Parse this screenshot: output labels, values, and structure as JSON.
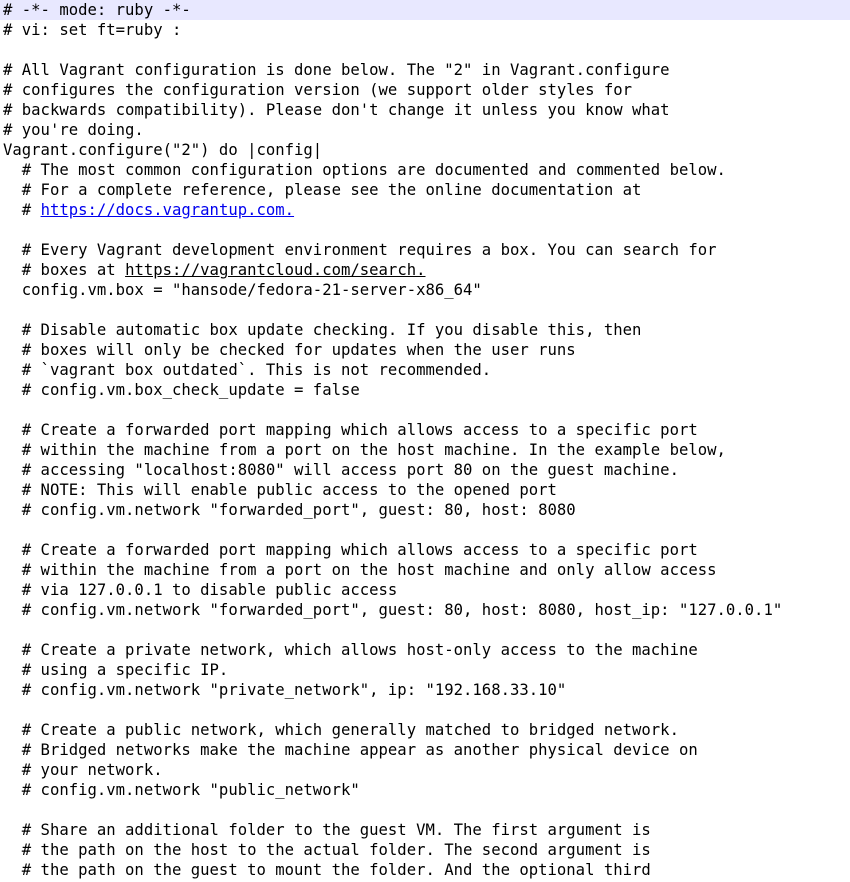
{
  "editor": {
    "current_line_color": "#e8e8ff",
    "link_color": "#0000ee",
    "lines": [
      {
        "text": "# -*- mode: ruby -*-"
      },
      {
        "text": "# vi: set ft=ruby :"
      },
      {
        "text": ""
      },
      {
        "text": "# All Vagrant configuration is done below. The \"2\" in Vagrant.configure"
      },
      {
        "text": "# configures the configuration version (we support older styles for"
      },
      {
        "text": "# backwards compatibility). Please don't change it unless you know what"
      },
      {
        "text": "# you're doing."
      },
      {
        "text": "Vagrant.configure(\"2\") do |config|"
      },
      {
        "text": "  # The most common configuration options are documented and commented below."
      },
      {
        "text": "  # For a complete reference, please see the online documentation at"
      },
      {
        "prefix": "  # ",
        "link": "https://docs.vagrantup.com.",
        "suffix": "",
        "link_style": "blue"
      },
      {
        "text": ""
      },
      {
        "text": "  # Every Vagrant development environment requires a box. You can search for"
      },
      {
        "prefix": "  # boxes at ",
        "link": "https://vagrantcloud.com/search.",
        "suffix": "",
        "link_style": "plain"
      },
      {
        "text": "  config.vm.box = \"hansode/fedora-21-server-x86_64\""
      },
      {
        "text": ""
      },
      {
        "text": "  # Disable automatic box update checking. If you disable this, then"
      },
      {
        "text": "  # boxes will only be checked for updates when the user runs"
      },
      {
        "text": "  # `vagrant box outdated`. This is not recommended."
      },
      {
        "text": "  # config.vm.box_check_update = false"
      },
      {
        "text": ""
      },
      {
        "text": "  # Create a forwarded port mapping which allows access to a specific port"
      },
      {
        "text": "  # within the machine from a port on the host machine. In the example below,"
      },
      {
        "text": "  # accessing \"localhost:8080\" will access port 80 on the guest machine."
      },
      {
        "text": "  # NOTE: This will enable public access to the opened port"
      },
      {
        "text": "  # config.vm.network \"forwarded_port\", guest: 80, host: 8080"
      },
      {
        "text": ""
      },
      {
        "text": "  # Create a forwarded port mapping which allows access to a specific port"
      },
      {
        "text": "  # within the machine from a port on the host machine and only allow access"
      },
      {
        "text": "  # via 127.0.0.1 to disable public access"
      },
      {
        "text": "  # config.vm.network \"forwarded_port\", guest: 80, host: 8080, host_ip: \"127.0.0.1\""
      },
      {
        "text": ""
      },
      {
        "text": "  # Create a private network, which allows host-only access to the machine"
      },
      {
        "text": "  # using a specific IP."
      },
      {
        "text": "  # config.vm.network \"private_network\", ip: \"192.168.33.10\""
      },
      {
        "text": ""
      },
      {
        "text": "  # Create a public network, which generally matched to bridged network."
      },
      {
        "text": "  # Bridged networks make the machine appear as another physical device on"
      },
      {
        "text": "  # your network."
      },
      {
        "text": "  # config.vm.network \"public_network\""
      },
      {
        "text": ""
      },
      {
        "text": "  # Share an additional folder to the guest VM. The first argument is"
      },
      {
        "text": "  # the path on the host to the actual folder. The second argument is"
      },
      {
        "text": "  # the path on the guest to mount the folder. And the optional third"
      }
    ]
  }
}
